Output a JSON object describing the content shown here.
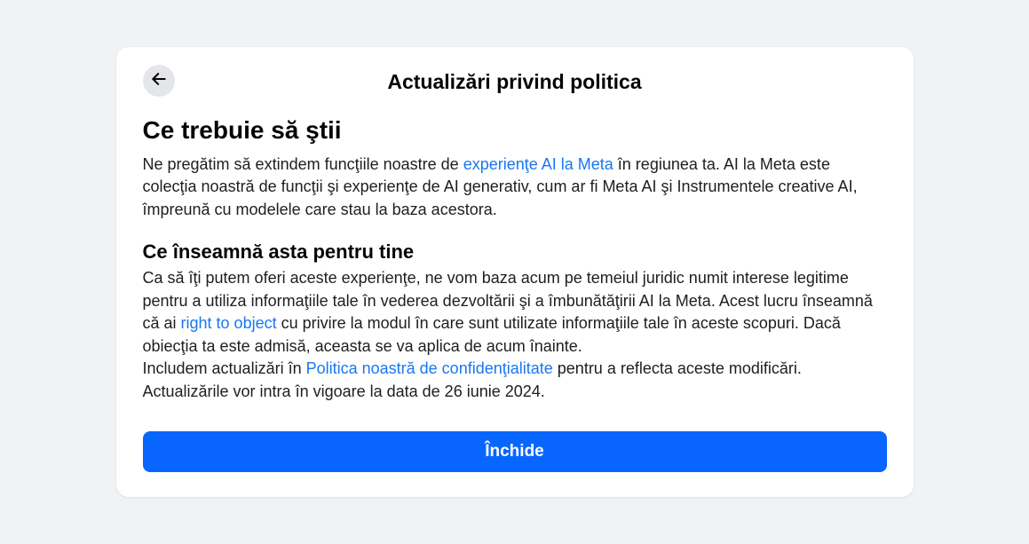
{
  "dialog": {
    "title": "Actualizări privind politica",
    "heading1": "Ce trebuie să ştii",
    "para1_a": "Ne pregătim să extindem funcţiile noastre de ",
    "link1": "experienţe AI la Meta",
    "para1_b": " în regiunea ta. AI la Meta este colecţia noastră de funcţii şi experienţe de AI generativ, cum ar fi Meta AI şi Instrumentele creative AI, împreună cu modelele care stau la baza acestora.",
    "heading2": "Ce înseamnă asta pentru tine",
    "para2_a": "Ca să îţi putem oferi aceste experienţe, ne vom baza acum pe temeiul juridic numit interese legitime pentru a utiliza informaţiile tale în vederea dezvoltării şi a îmbunătăţirii AI la Meta. Acest lucru înseamnă că ai ",
    "link2": "right to object",
    "para2_b": " cu privire la modul în care sunt utilizate informaţiile tale în aceste scopuri. Dacă obiecţia ta este admisă, aceasta se va aplica de acum înainte.",
    "para3_a": "Includem actualizări în ",
    "link3": "Politica noastră de confidenţialitate",
    "para3_b": " pentru a reflecta aceste modificări. Actualizările vor intra în vigoare la data de 26 iunie 2024.",
    "close_label": "Închide"
  }
}
